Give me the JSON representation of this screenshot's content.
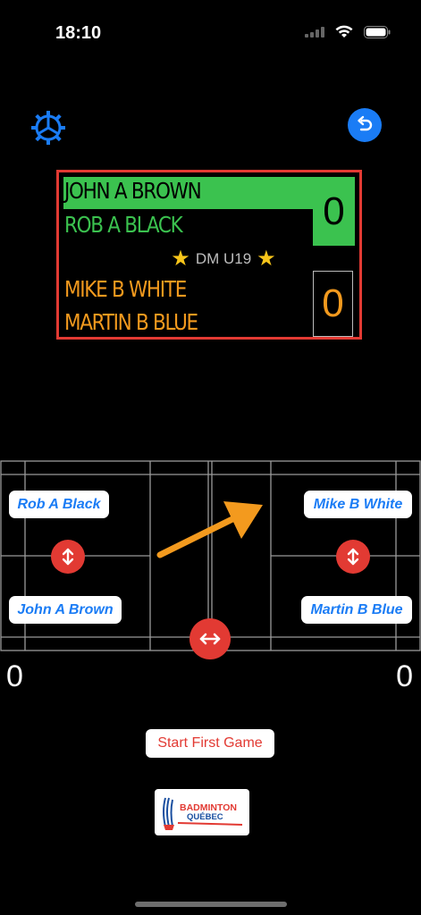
{
  "status_bar": {
    "time": "18:10"
  },
  "scoreboard": {
    "team1": {
      "player1": "JOHN A BROWN",
      "player2": "ROB A BLACK",
      "score": "0"
    },
    "team2": {
      "player1": "MIKE B WHITE",
      "player2": "MARTIN B BLUE",
      "score": "0"
    },
    "event": "DM U19"
  },
  "court": {
    "left_top_player": "Rob A Black",
    "left_bottom_player": "John A Brown",
    "right_top_player": "Mike B White",
    "right_bottom_player": "Martin B Blue"
  },
  "scores": {
    "left": "0",
    "right": "0"
  },
  "actions": {
    "start_label": "Start First Game"
  },
  "logo": {
    "line1": "BADMINTON",
    "line2": "QUÉBEC"
  },
  "colors": {
    "accent_blue": "#1a7cf5",
    "serving_green": "#3bc24f",
    "receiving_orange": "#f39a1e",
    "alert_red": "#e23a33"
  },
  "icons": {
    "settings": "gear-icon",
    "undo": "undo-icon",
    "swap_vertical": "swap-vertical-icon",
    "swap_horizontal": "swap-horizontal-icon",
    "serve_direction": "serve-arrow-icon"
  }
}
